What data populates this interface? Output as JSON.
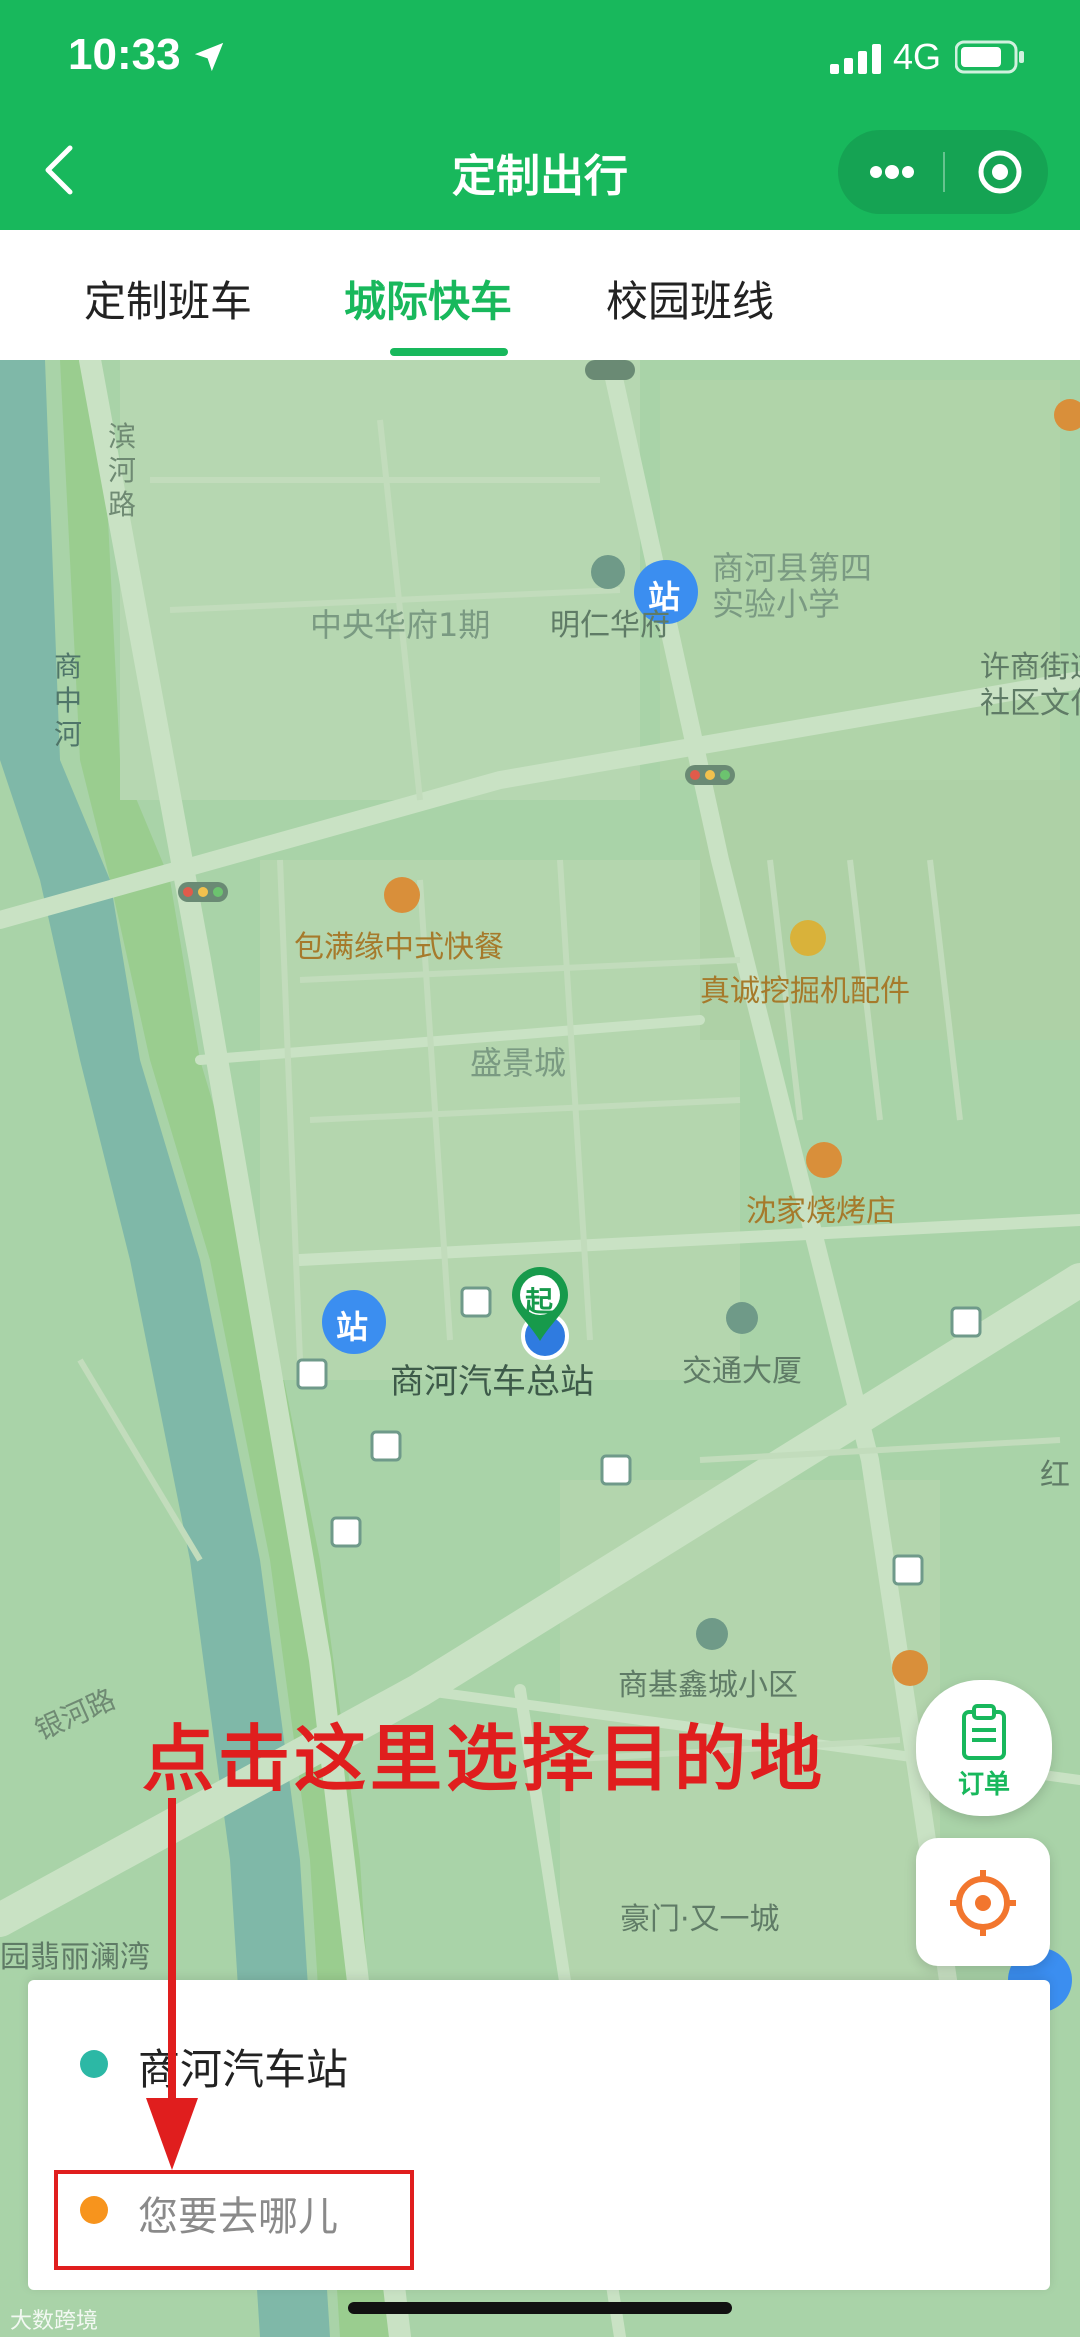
{
  "status_bar": {
    "time": "10:33",
    "network": "4G"
  },
  "nav": {
    "title": "定制出行"
  },
  "tabs": [
    {
      "label": "定制班车"
    },
    {
      "label": "城际快车"
    },
    {
      "label": "校园班线"
    }
  ],
  "map": {
    "pois": {
      "binhe_road": "滨\n河\n路",
      "shangzhong_river": "商\n中\n河",
      "zhongyang_huafu": "中央华府1期",
      "mingren_huafu": "明仁华府",
      "school": "商河县第四\n实验小学",
      "xunan_community": "许商街道\n社区文化",
      "baomanyuan": "包满缘中式快餐",
      "zhencheng": "真诚挖掘机配件",
      "shengjingcheng": "盛景城",
      "shenjia": "沈家烧烤店",
      "bus_station": "商河汽车总站",
      "jiaotong": "交通大厦",
      "hong": "红",
      "shangji": "商基鑫城小区",
      "yinhe_road": "银河路",
      "haomen": "豪门·又一城",
      "feicui": "园翡丽澜湾",
      "start_marker": "起",
      "station_1": "站",
      "station_2": "站"
    }
  },
  "instruction": "点击这里选择目的地",
  "order_button": {
    "label": "订单"
  },
  "panel": {
    "from": "商河汽车站",
    "to_placeholder": "您要去哪儿"
  },
  "watermark": "大数跨境",
  "colors": {
    "brand": "#18b85c",
    "from_dot": "#2cb8a5",
    "to_dot": "#f7941d",
    "alert": "#e01e1e"
  }
}
